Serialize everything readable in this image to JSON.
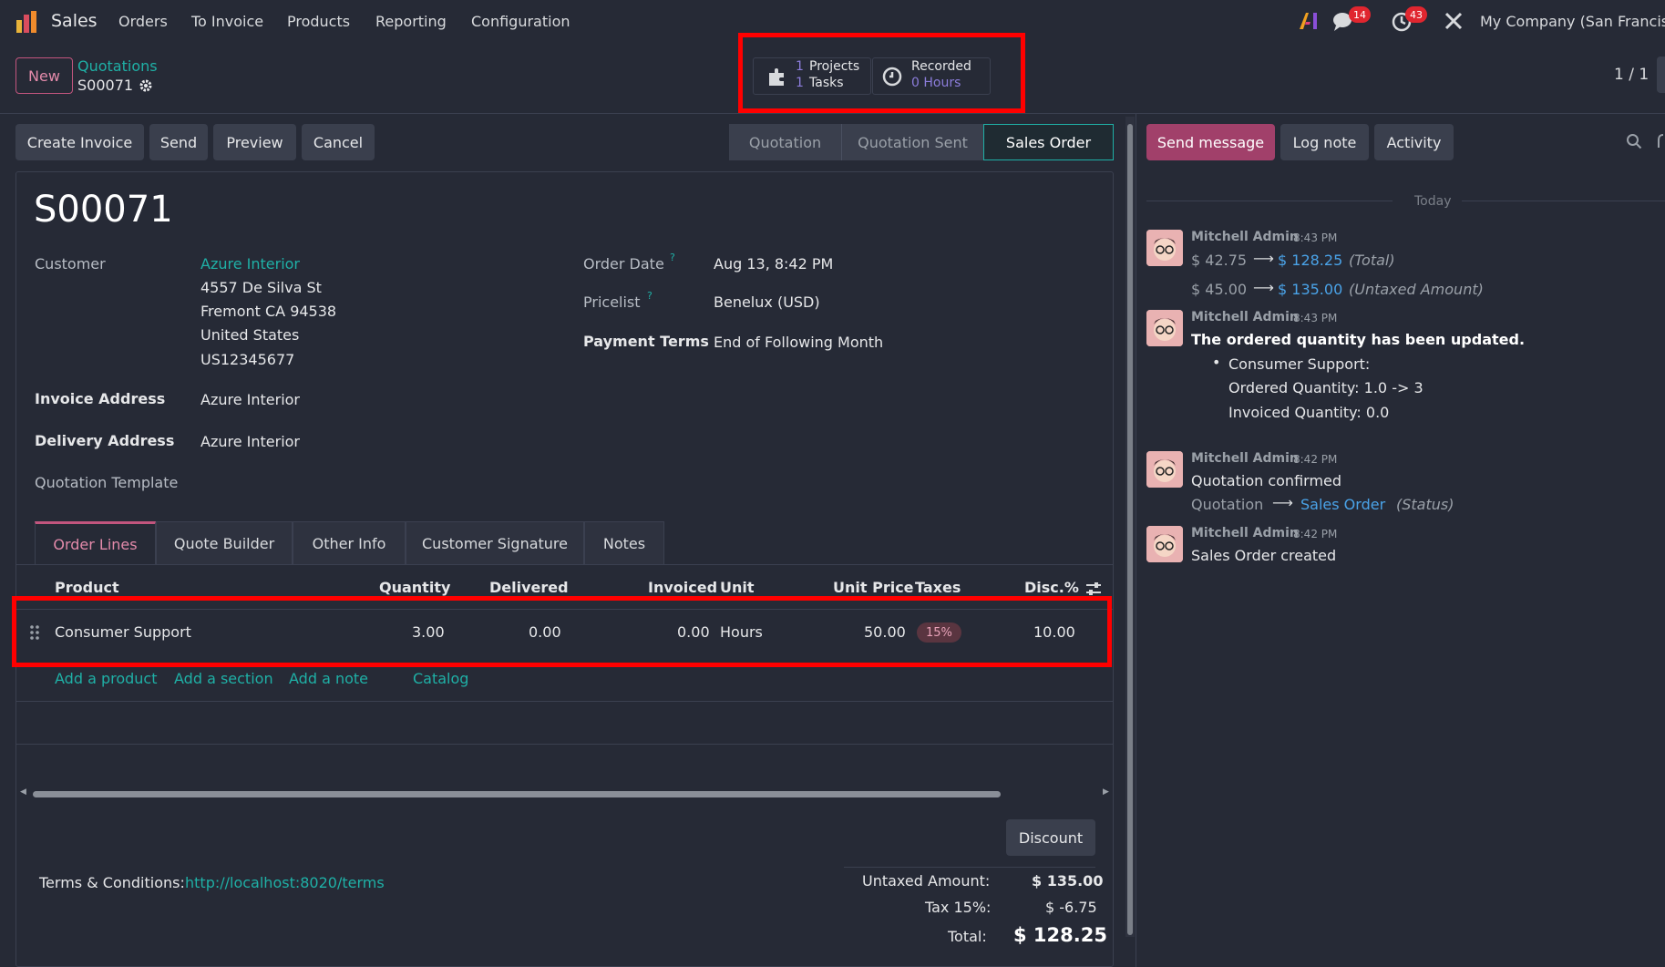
{
  "nav": {
    "app_name": "Sales",
    "menu": [
      "Orders",
      "To Invoice",
      "Products",
      "Reporting",
      "Configuration"
    ],
    "chat_count": "14",
    "activity_count": "43",
    "company": "My Company (San Francisco)"
  },
  "control": {
    "new_label": "New",
    "breadcrumb_parent": "Quotations",
    "breadcrumb_current": "S00071",
    "projects_count": "1",
    "projects_label": "Projects",
    "tasks_count": "1",
    "tasks_label": "Tasks",
    "recorded_label": "Recorded",
    "recorded_value": "0 Hours",
    "pager": "1 / 1"
  },
  "actions": {
    "create_invoice": "Create Invoice",
    "send": "Send",
    "preview": "Preview",
    "cancel": "Cancel"
  },
  "status": {
    "steps": [
      "Quotation",
      "Quotation Sent",
      "Sales Order"
    ],
    "active": "Sales Order"
  },
  "form": {
    "title": "S00071",
    "customer_label": "Customer",
    "customer_name": "Azure Interior",
    "address_lines": [
      "4557 De Silva St",
      "Fremont CA 94538",
      "United States",
      "US12345677"
    ],
    "invoice_address_label": "Invoice Address",
    "invoice_address": "Azure Interior",
    "delivery_address_label": "Delivery Address",
    "delivery_address": "Azure Interior",
    "quotation_template_label": "Quotation Template",
    "order_date_label": "Order Date",
    "order_date": "Aug 13, 8:42 PM",
    "pricelist_label": "Pricelist",
    "pricelist": "Benelux (USD)",
    "payment_terms_label": "Payment Terms",
    "payment_terms": "End of Following Month",
    "help_mark": "?"
  },
  "tabs": [
    "Order Lines",
    "Quote Builder",
    "Other Info",
    "Customer Signature",
    "Notes"
  ],
  "order_lines": {
    "headers": [
      "Product",
      "Quantity",
      "Delivered",
      "Invoiced",
      "Unit",
      "Unit Price",
      "Taxes",
      "Disc.%"
    ],
    "rows": [
      {
        "product": "Consumer Support",
        "quantity": "3.00",
        "delivered": "0.00",
        "invoiced": "0.00",
        "unit": "Hours",
        "unit_price": "50.00",
        "taxes": "15%",
        "discount": "10.00"
      }
    ],
    "add_product": "Add a product",
    "add_section": "Add a section",
    "add_note": "Add a note",
    "catalog": "Catalog"
  },
  "footer": {
    "discount_button": "Discount",
    "terms_label": "Terms & Conditions:",
    "terms_link": "http://localhost:8020/terms",
    "untaxed_label": "Untaxed Amount:",
    "untaxed_value": "$ 135.00",
    "tax_label": "Tax 15%:",
    "tax_value": "$ -6.75",
    "total_label": "Total:",
    "total_value": "$ 128.25"
  },
  "chatter": {
    "send_message": "Send message",
    "log_note": "Log note",
    "activity": "Activity",
    "date_separator": "Today",
    "messages": [
      {
        "author": "Mitchell Admin",
        "time": "8:43 PM",
        "old1": "$ 42.75",
        "new1": "$ 128.25",
        "field1": "(Total)",
        "old2": "$ 45.00",
        "new2": "$ 135.00",
        "field2": "(Untaxed Amount)"
      },
      {
        "author": "Mitchell Admin",
        "time": "8:43 PM",
        "heading": "The ordered quantity has been updated.",
        "item": "Consumer Support:",
        "line1": "Ordered Quantity: 1.0 -> 3",
        "line2": "Invoiced Quantity: 0.0"
      },
      {
        "author": "Mitchell Admin",
        "time": "8:42 PM",
        "body": "Quotation confirmed",
        "old": "Quotation",
        "new": "Sales Order",
        "field": "(Status)"
      },
      {
        "author": "Mitchell Admin",
        "time": "8:42 PM",
        "body": "Sales Order created"
      }
    ]
  },
  "colors": {
    "accent": "#1fb0a6",
    "primary": "#a1406a",
    "highlight": "#ff0000",
    "background": "#262a36"
  }
}
